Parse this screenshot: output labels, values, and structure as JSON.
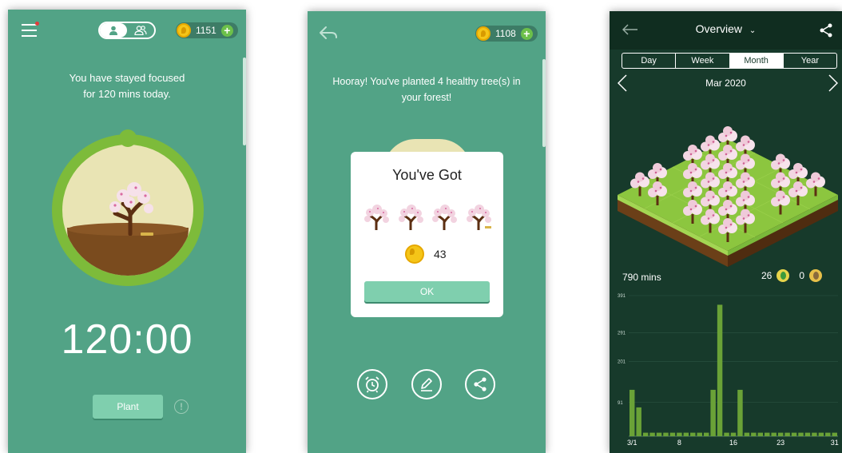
{
  "screen1": {
    "coins": "1151",
    "focus_text_line1": "You have stayed focused",
    "focus_text_line2": "for 120 mins today.",
    "timer": "120:00",
    "plant_label": "Plant",
    "info_glyph": "!"
  },
  "screen2": {
    "coins": "1108",
    "message_line1": "Hooray! You've planted 4 healthy tree(s) in",
    "message_line2": "your forest!",
    "dialog_title": "You've Got",
    "coin_reward": "43",
    "ok_label": "OK"
  },
  "screen3": {
    "title": "Overview",
    "tabs": [
      "Day",
      "Week",
      "Month",
      "Year"
    ],
    "active_tab": "Month",
    "period": "Mar 2020",
    "total_mins": "790 mins",
    "healthy_trees": "26",
    "dead_trees": "0"
  },
  "chart_data": {
    "type": "bar",
    "x": [
      1,
      2,
      3,
      4,
      5,
      6,
      7,
      8,
      9,
      10,
      11,
      12,
      13,
      14,
      15,
      16,
      17,
      18,
      19,
      20,
      21,
      22,
      23,
      24,
      25,
      26,
      27,
      28,
      29,
      30,
      31
    ],
    "values": [
      66,
      41,
      5,
      5,
      5,
      5,
      5,
      5,
      5,
      5,
      5,
      5,
      66,
      187,
      5,
      5,
      66,
      5,
      5,
      5,
      5,
      5,
      5,
      5,
      5,
      5,
      5,
      5,
      5,
      5,
      5
    ],
    "x_tick_labels": [
      "3/1",
      "8",
      "16",
      "23",
      "31"
    ],
    "x_tick_positions": [
      1,
      8,
      16,
      23,
      31
    ],
    "y_tick_labels": [
      "391",
      "291",
      "201",
      "91"
    ],
    "ylim": [
      0,
      200
    ],
    "bar_color": "#6aa237",
    "grid": true
  },
  "colors": {
    "panel_green": "#52a386",
    "dark_forest": "#173a2b",
    "bar_green": "#6aa237",
    "coin_yellow": "#f5c518"
  }
}
